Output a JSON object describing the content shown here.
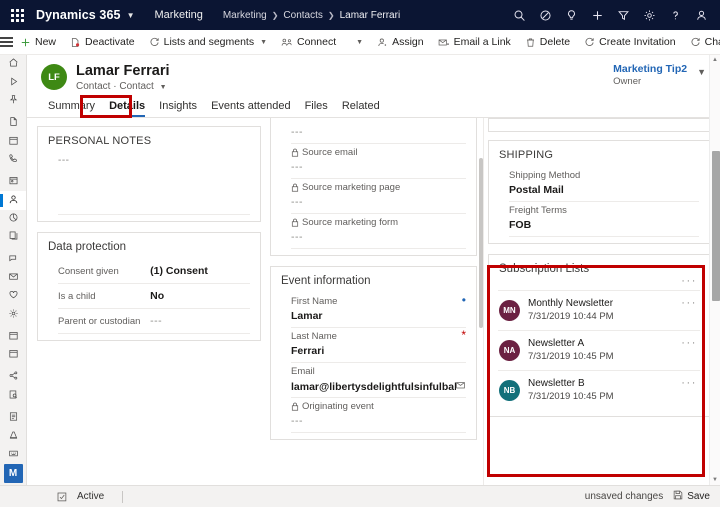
{
  "topnav": {
    "waffle_label": "app-launcher",
    "brand": "Dynamics 365",
    "app_name": "Marketing",
    "breadcrumb": [
      "Marketing",
      "Contacts",
      "Lamar Ferrari"
    ],
    "icons": [
      {
        "name": "search-icon",
        "title": "Search"
      },
      {
        "name": "assistant-icon",
        "title": "Assistant"
      },
      {
        "name": "lightbulb-icon",
        "title": "Insights"
      },
      {
        "name": "plus-icon",
        "title": "New"
      },
      {
        "name": "filter-icon",
        "title": "Filter"
      },
      {
        "name": "gear-icon",
        "title": "Settings"
      },
      {
        "name": "help-icon",
        "title": "Help"
      },
      {
        "name": "person-icon",
        "title": "Account"
      }
    ]
  },
  "commandbar": {
    "items": [
      {
        "label": "New",
        "icon": "plus-icon",
        "chevron": false
      },
      {
        "label": "Deactivate",
        "icon": "deactivate-icon",
        "chevron": false
      },
      {
        "label": "Lists and segments",
        "icon": "lists-icon",
        "chevron": true
      },
      {
        "label": "Connect",
        "icon": "connect-icon",
        "chevron": true
      },
      {
        "label": "Assign",
        "icon": "assign-icon",
        "chevron": false
      },
      {
        "label": "Email a Link",
        "icon": "email-link-icon",
        "chevron": false
      },
      {
        "label": "Delete",
        "icon": "delete-icon",
        "chevron": false
      },
      {
        "label": "Create Invitation",
        "icon": "invitation-icon",
        "chevron": false
      },
      {
        "label": "Change Password",
        "icon": "password-icon",
        "chevron": false
      }
    ],
    "overflow": "···"
  },
  "record": {
    "avatar_initials": "LF",
    "title": "Lamar Ferrari",
    "subtitle": "Contact · Contact",
    "owner_name": "Marketing Tip2",
    "owner_label": "Owner"
  },
  "tabs": [
    {
      "label": "Summary",
      "active": false
    },
    {
      "label": "Details",
      "active": true
    },
    {
      "label": "Insights",
      "active": false
    },
    {
      "label": "Events attended",
      "active": false
    },
    {
      "label": "Files",
      "active": false
    },
    {
      "label": "Related",
      "active": false
    }
  ],
  "column1": {
    "personal_notes": {
      "title": "PERSONAL NOTES",
      "value": "---"
    },
    "data_protection": {
      "title": "Data protection",
      "fields": [
        {
          "label": "Consent given",
          "value": "(1) Consent",
          "muted": false
        },
        {
          "label": "Is a child",
          "value": "No",
          "muted": false
        },
        {
          "label": "Parent or custodian",
          "value": "---",
          "muted": true
        }
      ]
    }
  },
  "column2": {
    "top_partial_value": "---",
    "locked_fields": [
      {
        "label": "Source email",
        "value": "---"
      },
      {
        "label": "Source marketing page",
        "value": "---"
      },
      {
        "label": "Source marketing form",
        "value": "---"
      }
    ],
    "event_information": {
      "title": "Event information",
      "fields": [
        {
          "label": "First Name",
          "value": "Lamar",
          "required": "blue",
          "locked": false,
          "muted": false
        },
        {
          "label": "Last Name",
          "value": "Ferrari",
          "required": "red",
          "locked": false,
          "muted": false
        },
        {
          "label": "Email",
          "value": "lamar@libertysdelightfulsinfulbakeryandcaf...",
          "required": "",
          "locked": false,
          "muted": false,
          "trailing_icon": "email-icon"
        },
        {
          "label": "Originating event",
          "value": "---",
          "required": "",
          "locked": true,
          "muted": true
        }
      ]
    }
  },
  "column3": {
    "shipping": {
      "title": "SHIPPING",
      "fields": [
        {
          "label": "Shipping Method",
          "value": "Postal Mail"
        },
        {
          "label": "Freight Terms",
          "value": "FOB"
        }
      ]
    },
    "subscription_lists": {
      "title": "Subscription Lists",
      "overflow": "···",
      "items": [
        {
          "initials": "MN",
          "name": "Monthly Newsletter",
          "date": "7/31/2019 10:44 PM",
          "color": "#6b2142",
          "overflow": "···"
        },
        {
          "initials": "NA",
          "name": "Newsletter A",
          "date": "7/31/2019 10:45 PM",
          "color": "#6b2142",
          "overflow": "···"
        },
        {
          "initials": "NB",
          "name": "Newsletter B",
          "date": "7/31/2019 10:45 PM",
          "color": "#12707a",
          "overflow": "···"
        }
      ]
    }
  },
  "rail": {
    "items": [
      {
        "name": "home-icon",
        "selected": false
      },
      {
        "name": "recent-icon",
        "selected": false
      },
      {
        "name": "pinned-icon",
        "selected": false
      },
      {
        "name": "file-icon",
        "selected": false
      },
      {
        "name": "calendar-icon",
        "selected": false
      },
      {
        "name": "phone-icon",
        "selected": false
      },
      {
        "name": "account-card-icon",
        "selected": false
      },
      {
        "name": "contact-person-icon",
        "selected": true
      },
      {
        "name": "segment-icon",
        "selected": false
      },
      {
        "name": "subscription-list-icon",
        "selected": false
      },
      {
        "name": "marketing-page-icon",
        "selected": false
      },
      {
        "name": "marketing-email-icon",
        "selected": false
      },
      {
        "name": "heart-icon",
        "selected": false
      },
      {
        "name": "customer-journey-icon",
        "selected": false
      },
      {
        "name": "event-calendar-icon",
        "selected": false
      },
      {
        "name": "session-calendar-icon",
        "selected": false
      },
      {
        "name": "social-post-icon",
        "selected": false
      },
      {
        "name": "lead-scoring-icon",
        "selected": false
      },
      {
        "name": "marketing-form-icon",
        "selected": false
      },
      {
        "name": "survey-icon",
        "selected": false
      },
      {
        "name": "keyword-icon",
        "selected": false
      }
    ],
    "bottom_badge": "M"
  },
  "statusbar": {
    "status": "Active",
    "unsaved": "unsaved changes",
    "save_label": "Save"
  },
  "annotations": {
    "accent_red": "#c00000",
    "brand_blue": "#2266b5"
  }
}
